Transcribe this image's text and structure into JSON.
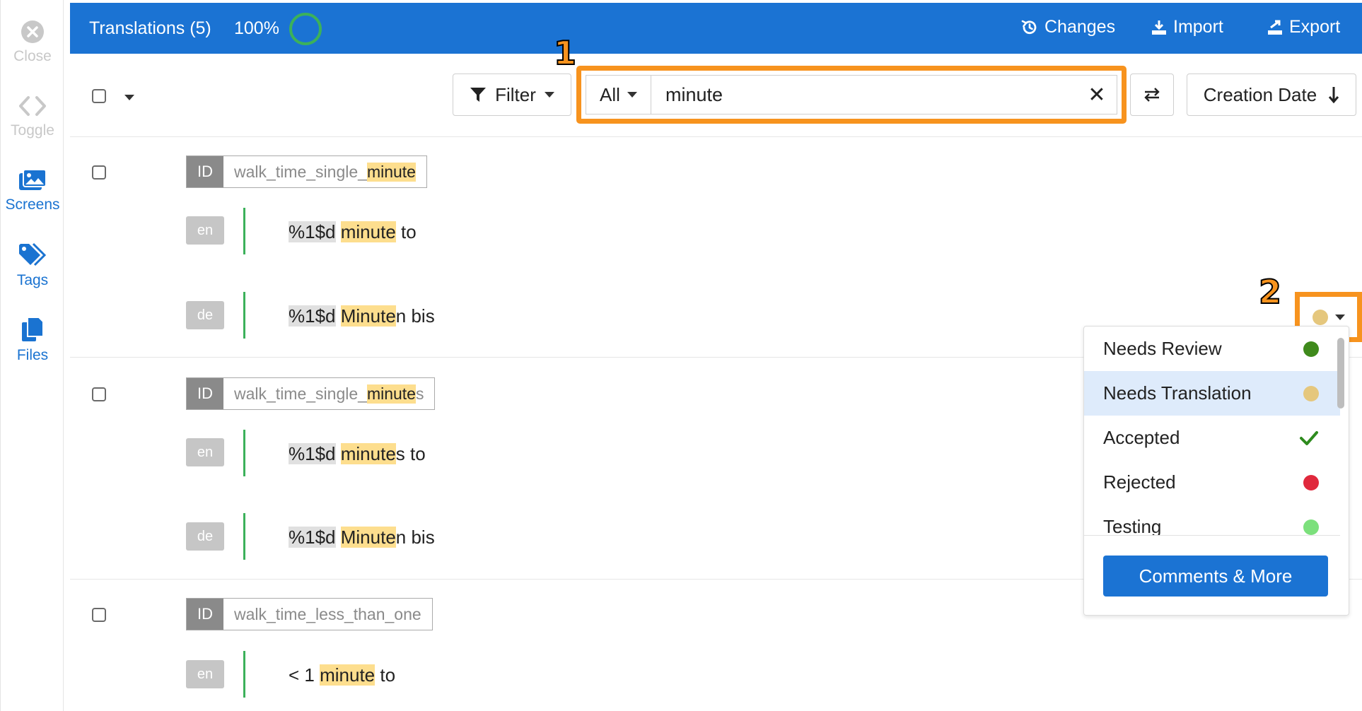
{
  "sidebar": {
    "items": [
      {
        "label": "Close",
        "icon": "close-icon"
      },
      {
        "label": "Toggle",
        "icon": "code-icon"
      },
      {
        "label": "Screens",
        "icon": "images-icon"
      },
      {
        "label": "Tags",
        "icon": "tags-icon"
      },
      {
        "label": "Files",
        "icon": "files-icon"
      }
    ]
  },
  "header": {
    "title": "Translations (5)",
    "progress": "100%",
    "progress_value": 100,
    "changes_label": "Changes",
    "import_label": "Import",
    "export_label": "Export"
  },
  "toolbar": {
    "filter_label": "Filter",
    "scope_label": "All",
    "search_value": "minute",
    "sort_label": "Creation Date"
  },
  "callouts": [
    "1",
    "2"
  ],
  "rows": [
    {
      "id_label": "ID",
      "key_prefix": "walk_time_single_",
      "key_match": "minute",
      "key_suffix": "",
      "translations": [
        {
          "lang": "en",
          "placeholder": "%1$d",
          "pre": " ",
          "match": "minute",
          "post": " to"
        },
        {
          "lang": "de",
          "placeholder": "%1$d",
          "pre": " ",
          "match": "Minute",
          "post": "n bis"
        }
      ]
    },
    {
      "id_label": "ID",
      "key_prefix": "walk_time_single_",
      "key_match": "minute",
      "key_suffix": "s",
      "translations": [
        {
          "lang": "en",
          "placeholder": "%1$d",
          "pre": " ",
          "match": "minute",
          "post": "s to"
        },
        {
          "lang": "de",
          "placeholder": "%1$d",
          "pre": " ",
          "match": "Minute",
          "post": "n bis"
        }
      ]
    },
    {
      "id_label": "ID",
      "key_prefix": "walk_time_less_than_one",
      "key_match": "",
      "key_suffix": "",
      "translations": [
        {
          "lang": "en",
          "placeholder": "",
          "pre": "< 1 ",
          "match": "minute",
          "post": " to"
        }
      ]
    }
  ],
  "status_menu": {
    "current_color": "#e5c77d",
    "items": [
      {
        "label": "Needs Review",
        "color": "#3f8a1c",
        "icon": "dot"
      },
      {
        "label": "Needs Translation",
        "color": "#e5c77d",
        "icon": "dot"
      },
      {
        "label": "Accepted",
        "color": "#2e8b1e",
        "icon": "check-icon"
      },
      {
        "label": "Rejected",
        "color": "#e0283c",
        "icon": "dot"
      },
      {
        "label": "Testing",
        "color": "#7ce07c",
        "icon": "dot"
      }
    ],
    "comments_label": "Comments & More"
  },
  "colors": {
    "brand": "#1b73d3",
    "highlight": "#fdde8e",
    "callout": "#f7931e",
    "progress_ring": "#3cb15a"
  }
}
